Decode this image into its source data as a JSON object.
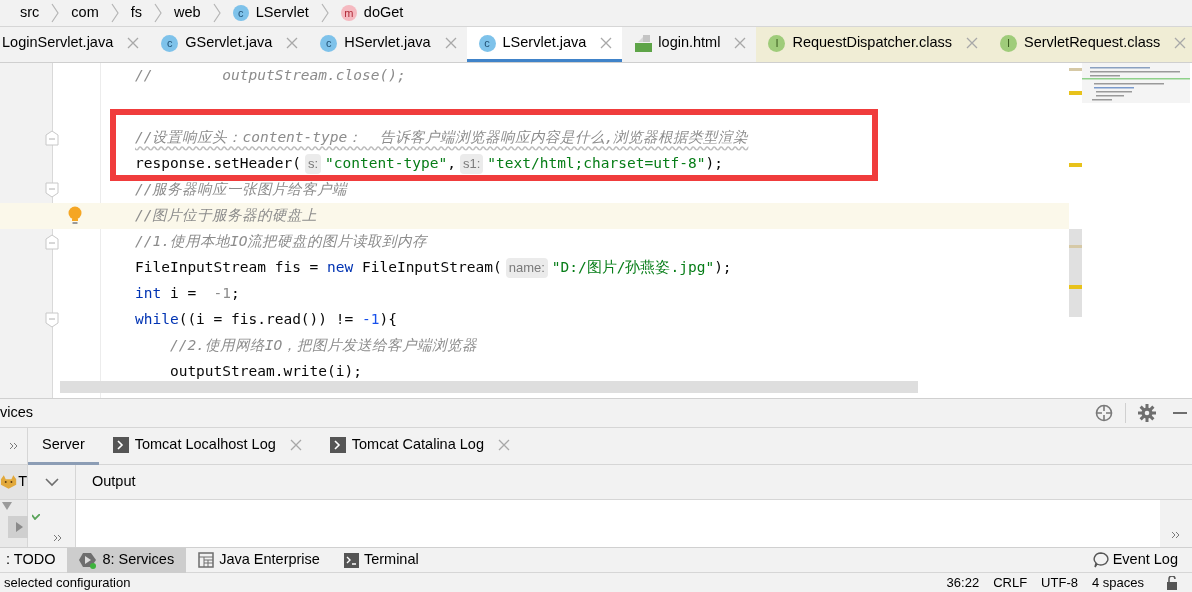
{
  "breadcrumbs": [
    {
      "label": "src"
    },
    {
      "label": "com"
    },
    {
      "label": "fs"
    },
    {
      "label": "web"
    },
    {
      "label": "LServlet",
      "kind": "class",
      "icon_letter": "c"
    },
    {
      "label": "doGet",
      "kind": "method",
      "icon_letter": "m"
    }
  ],
  "editor_tabs": [
    {
      "label": "LoginServlet.java",
      "selected": false,
      "read_only": false
    },
    {
      "label": "GServlet.java",
      "kind": "class",
      "icon_letter": "c",
      "selected": false,
      "read_only": false
    },
    {
      "label": "HServlet.java",
      "kind": "class",
      "icon_letter": "c",
      "selected": false,
      "read_only": false
    },
    {
      "label": "LServlet.java",
      "kind": "class",
      "icon_letter": "c",
      "selected": true,
      "read_only": false
    },
    {
      "label": "login.html",
      "kind": "html",
      "selected": false,
      "read_only": false
    },
    {
      "label": "RequestDispatcher.class",
      "kind": "interface",
      "icon_letter": "I",
      "selected": false,
      "read_only": true
    },
    {
      "label": "ServletRequest.class",
      "kind": "interface",
      "icon_letter": "I",
      "selected": false,
      "read_only": true
    }
  ],
  "editor": {
    "lines": [
      {
        "tokens": [
          {
            "text": "//        outputStream.close();",
            "kind": "comment"
          }
        ]
      },
      {
        "blank": true
      },
      {
        "blank": true
      },
      {
        "boxed": true,
        "fold_start": true,
        "tokens": [
          {
            "text": "//设置响应头：content-type：  告诉客户端浏览器响应内容是什么,浏览器根据类型渲染",
            "kind": "comment",
            "wavy": true
          }
        ]
      },
      {
        "boxed": true,
        "tokens": [
          {
            "text": "response.setHeader(",
            "kind": "plain"
          },
          {
            "text": "s:",
            "kind": "hint"
          },
          {
            "text": "\"content-type\"",
            "kind": "string"
          },
          {
            "text": ",",
            "kind": "plain"
          },
          {
            "text": "s1:",
            "kind": "hint"
          },
          {
            "text": "\"text/html;charset=utf-8\"",
            "kind": "string"
          },
          {
            "text": ");",
            "kind": "plain"
          }
        ]
      },
      {
        "fold_end": true,
        "tokens": [
          {
            "text": "//服务器响应一张图片给客户端",
            "kind": "comment"
          }
        ]
      },
      {
        "current": true,
        "tokens": [
          {
            "text": "//图片位于服务器的硬盘上",
            "kind": "comment"
          }
        ]
      },
      {
        "fold_start": true,
        "tokens": [
          {
            "text": "//1.使用本地IO流把硬盘的图片读取到内存",
            "kind": "comment"
          }
        ]
      },
      {
        "tokens": [
          {
            "text": "FileInputStream fis = ",
            "kind": "plain"
          },
          {
            "text": "new",
            "kind": "keyword"
          },
          {
            "text": " FileInputStream(",
            "kind": "plain"
          },
          {
            "text": "name:",
            "kind": "hint"
          },
          {
            "text": "\"D:/图片/孙燕姿.jpg\"",
            "kind": "string"
          },
          {
            "text": ");",
            "kind": "plain"
          }
        ]
      },
      {
        "tokens": [
          {
            "text": "int",
            "kind": "keyword"
          },
          {
            "text": " i =  ",
            "kind": "plain"
          },
          {
            "text": "-1",
            "kind": "dim"
          },
          {
            "text": ";",
            "kind": "plain"
          }
        ]
      },
      {
        "fold_end": true,
        "tokens": [
          {
            "text": "while",
            "kind": "keyword"
          },
          {
            "text": "((i = fis.read()) != ",
            "kind": "plain"
          },
          {
            "text": "-1",
            "kind": "number"
          },
          {
            "text": "){",
            "kind": "plain"
          }
        ]
      },
      {
        "tokens": [
          {
            "text": "    //2.使用网络IO，把图片发送给客户端浏览器",
            "kind": "comment"
          }
        ]
      },
      {
        "tokens": [
          {
            "text": "    outputStream.write(i);",
            "kind": "plain"
          }
        ]
      }
    ]
  },
  "services": {
    "title": "vices",
    "tree_stub": "T",
    "tabs": [
      {
        "label": "Server",
        "kind": "plain",
        "selected": true
      },
      {
        "label": "Tomcat Localhost Log",
        "kind": "log",
        "selected": false
      },
      {
        "label": "Tomcat Catalina Log",
        "kind": "log",
        "selected": false
      }
    ],
    "output_header": "Output"
  },
  "tool_windows": [
    {
      "label": ": TODO",
      "kind": "todo",
      "selected": false
    },
    {
      "label": "8: Services",
      "kind": "services",
      "selected": true
    },
    {
      "label": "Java Enterprise",
      "kind": "enterprise",
      "selected": false
    },
    {
      "label": "Terminal",
      "kind": "terminal",
      "selected": false
    }
  ],
  "event_log": "Event Log",
  "status_bar": {
    "message": "selected configuration",
    "items": [
      "36:22",
      "CRLF",
      "UTF-8",
      "4 spaces"
    ]
  }
}
